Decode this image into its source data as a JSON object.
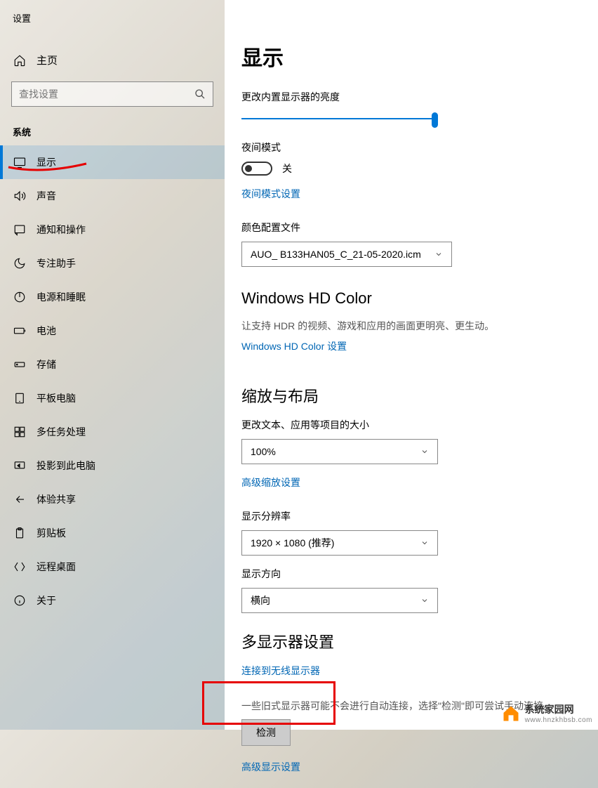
{
  "app_title": "设置",
  "sidebar": {
    "home": "主页",
    "search_placeholder": "查找设置",
    "category": "系统",
    "items": [
      {
        "label": "显示",
        "icon": "display-icon",
        "active": true
      },
      {
        "label": "声音",
        "icon": "sound-icon"
      },
      {
        "label": "通知和操作",
        "icon": "notification-icon"
      },
      {
        "label": "专注助手",
        "icon": "moon-icon"
      },
      {
        "label": "电源和睡眠",
        "icon": "power-icon"
      },
      {
        "label": "电池",
        "icon": "battery-icon"
      },
      {
        "label": "存储",
        "icon": "storage-icon"
      },
      {
        "label": "平板电脑",
        "icon": "tablet-icon"
      },
      {
        "label": "多任务处理",
        "icon": "multitask-icon"
      },
      {
        "label": "投影到此电脑",
        "icon": "project-icon"
      },
      {
        "label": "体验共享",
        "icon": "share-icon"
      },
      {
        "label": "剪贴板",
        "icon": "clipboard-icon"
      },
      {
        "label": "远程桌面",
        "icon": "remote-icon"
      },
      {
        "label": "关于",
        "icon": "info-icon"
      }
    ]
  },
  "main": {
    "title": "显示",
    "brightness_label": "更改内置显示器的亮度",
    "night_mode_label": "夜间模式",
    "toggle_off": "关",
    "night_mode_link": "夜间模式设置",
    "color_profile_label": "颜色配置文件",
    "color_profile_value": "AUO_        B133HAN05_C_21-05-2020.icm",
    "hd_color_title": "Windows HD Color",
    "hd_color_desc": "让支持 HDR 的视频、游戏和应用的画面更明亮、更生动。",
    "hd_color_link": "Windows HD Color 设置",
    "scale_title": "缩放与布局",
    "scale_label": "更改文本、应用等项目的大小",
    "scale_value": "100%",
    "scale_link": "高级缩放设置",
    "resolution_label": "显示分辨率",
    "resolution_value": "1920 × 1080 (推荐)",
    "orientation_label": "显示方向",
    "orientation_value": "横向",
    "multi_display_title": "多显示器设置",
    "wireless_link": "连接到无线显示器",
    "multi_display_desc": "一些旧式显示器可能不会进行自动连接，选择\"检测\"即可尝试手动连接。",
    "detect_button": "检测",
    "advanced_link": "高级显示设置"
  },
  "watermark": {
    "title": "系统家园网",
    "sub": "www.hnzkhbsb.com"
  }
}
